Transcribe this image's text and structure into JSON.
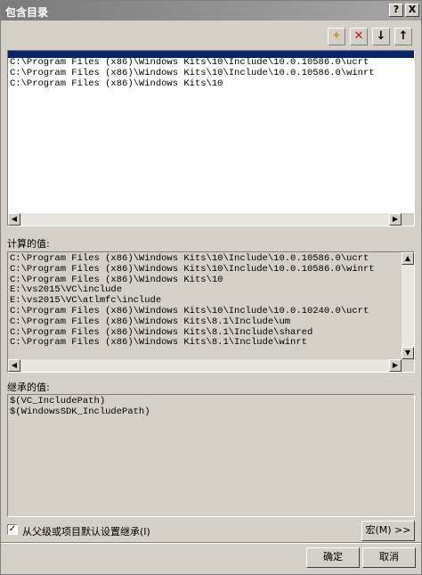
{
  "window": {
    "title": "包含目录",
    "help_glyph": "?",
    "close_glyph": "X"
  },
  "toolbar": {
    "new_glyph": "✦",
    "delete_glyph": "✕",
    "down_glyph": "↓",
    "up_glyph": "↑"
  },
  "edit_list": {
    "lines": [
      "C:\\Program Files (x86)\\Windows Kits\\10\\Include\\10.0.10586.0\\ucrt",
      "C:\\Program Files (x86)\\Windows Kits\\10\\Include\\10.0.10586.0\\winrt",
      "C:\\Program Files (x86)\\Windows Kits\\10"
    ]
  },
  "evaluated": {
    "label": "计算的值:",
    "lines": [
      "C:\\Program Files (x86)\\Windows Kits\\10\\Include\\10.0.10586.0\\ucrt",
      "C:\\Program Files (x86)\\Windows Kits\\10\\Include\\10.0.10586.0\\winrt",
      "C:\\Program Files (x86)\\Windows Kits\\10",
      "E:\\vs2015\\VC\\include",
      "E:\\vs2015\\VC\\atlmfc\\include",
      "C:\\Program Files (x86)\\Windows Kits\\10\\Include\\10.0.10240.0\\ucrt",
      "C:\\Program Files (x86)\\Windows Kits\\8.1\\Include\\um",
      "C:\\Program Files (x86)\\Windows Kits\\8.1\\Include\\shared",
      "C:\\Program Files (x86)\\Windows Kits\\8.1\\Include\\winrt"
    ]
  },
  "inherited": {
    "label": "继承的值:",
    "lines": [
      "$(VC_IncludePath)",
      "$(WindowsSDK_IncludePath)"
    ]
  },
  "inherit_checkbox": {
    "label": "从父级或项目默认设置继承(I)",
    "checked_glyph": "✓"
  },
  "buttons": {
    "macros": "宏(M) >>",
    "ok": "确定",
    "cancel": "取消"
  },
  "scroll": {
    "left": "◀",
    "right": "▶",
    "up": "▲",
    "down": "▼"
  }
}
